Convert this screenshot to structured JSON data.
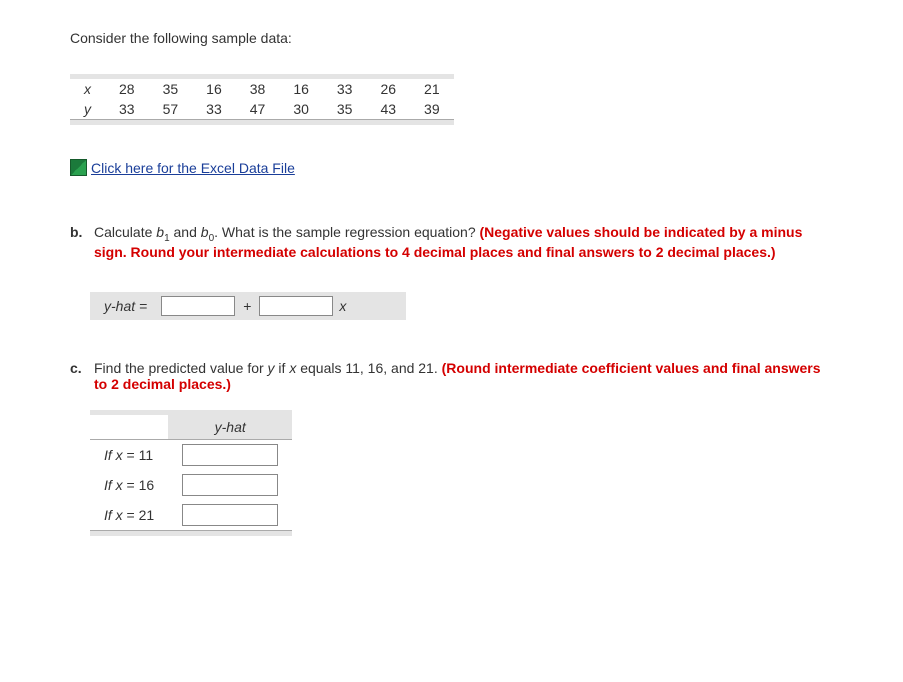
{
  "intro": "Consider the following sample data:",
  "data": {
    "row_x_label": "x",
    "row_y_label": "y",
    "x": [
      "28",
      "35",
      "16",
      "38",
      "16",
      "33",
      "26",
      "21"
    ],
    "y": [
      "33",
      "57",
      "33",
      "47",
      "30",
      "35",
      "43",
      "39"
    ]
  },
  "excel_link": "Click here for the Excel Data File",
  "partB": {
    "marker": "b.",
    "text_before": "Calculate ",
    "b1": "b",
    "sub1": "1",
    "and": " and ",
    "b0": "b",
    "sub0": "0",
    "text_mid": ". What is the sample regression equation? ",
    "red": "(Negative values should be indicated by a minus sign. Round your intermediate calculations to 4 decimal places and final answers to 2 decimal places.)",
    "yhat_label": "y-hat =",
    "plus": "+",
    "xlab": "x"
  },
  "partC": {
    "marker": "c.",
    "text_before": "Find the predicted value for ",
    "y": "y",
    "if": " if ",
    "x": "x",
    "text_mid": " equals 11, 16, and 21. ",
    "red": "(Round intermediate coefficient values and final answers to 2 decimal places.)",
    "yhat_header": "y-hat",
    "rows": [
      {
        "label_if": "If ",
        "label_x": "x",
        "label_eq": " = 11"
      },
      {
        "label_if": "If ",
        "label_x": "x",
        "label_eq": " = 16"
      },
      {
        "label_if": "If ",
        "label_x": "x",
        "label_eq": " = 21"
      }
    ]
  }
}
